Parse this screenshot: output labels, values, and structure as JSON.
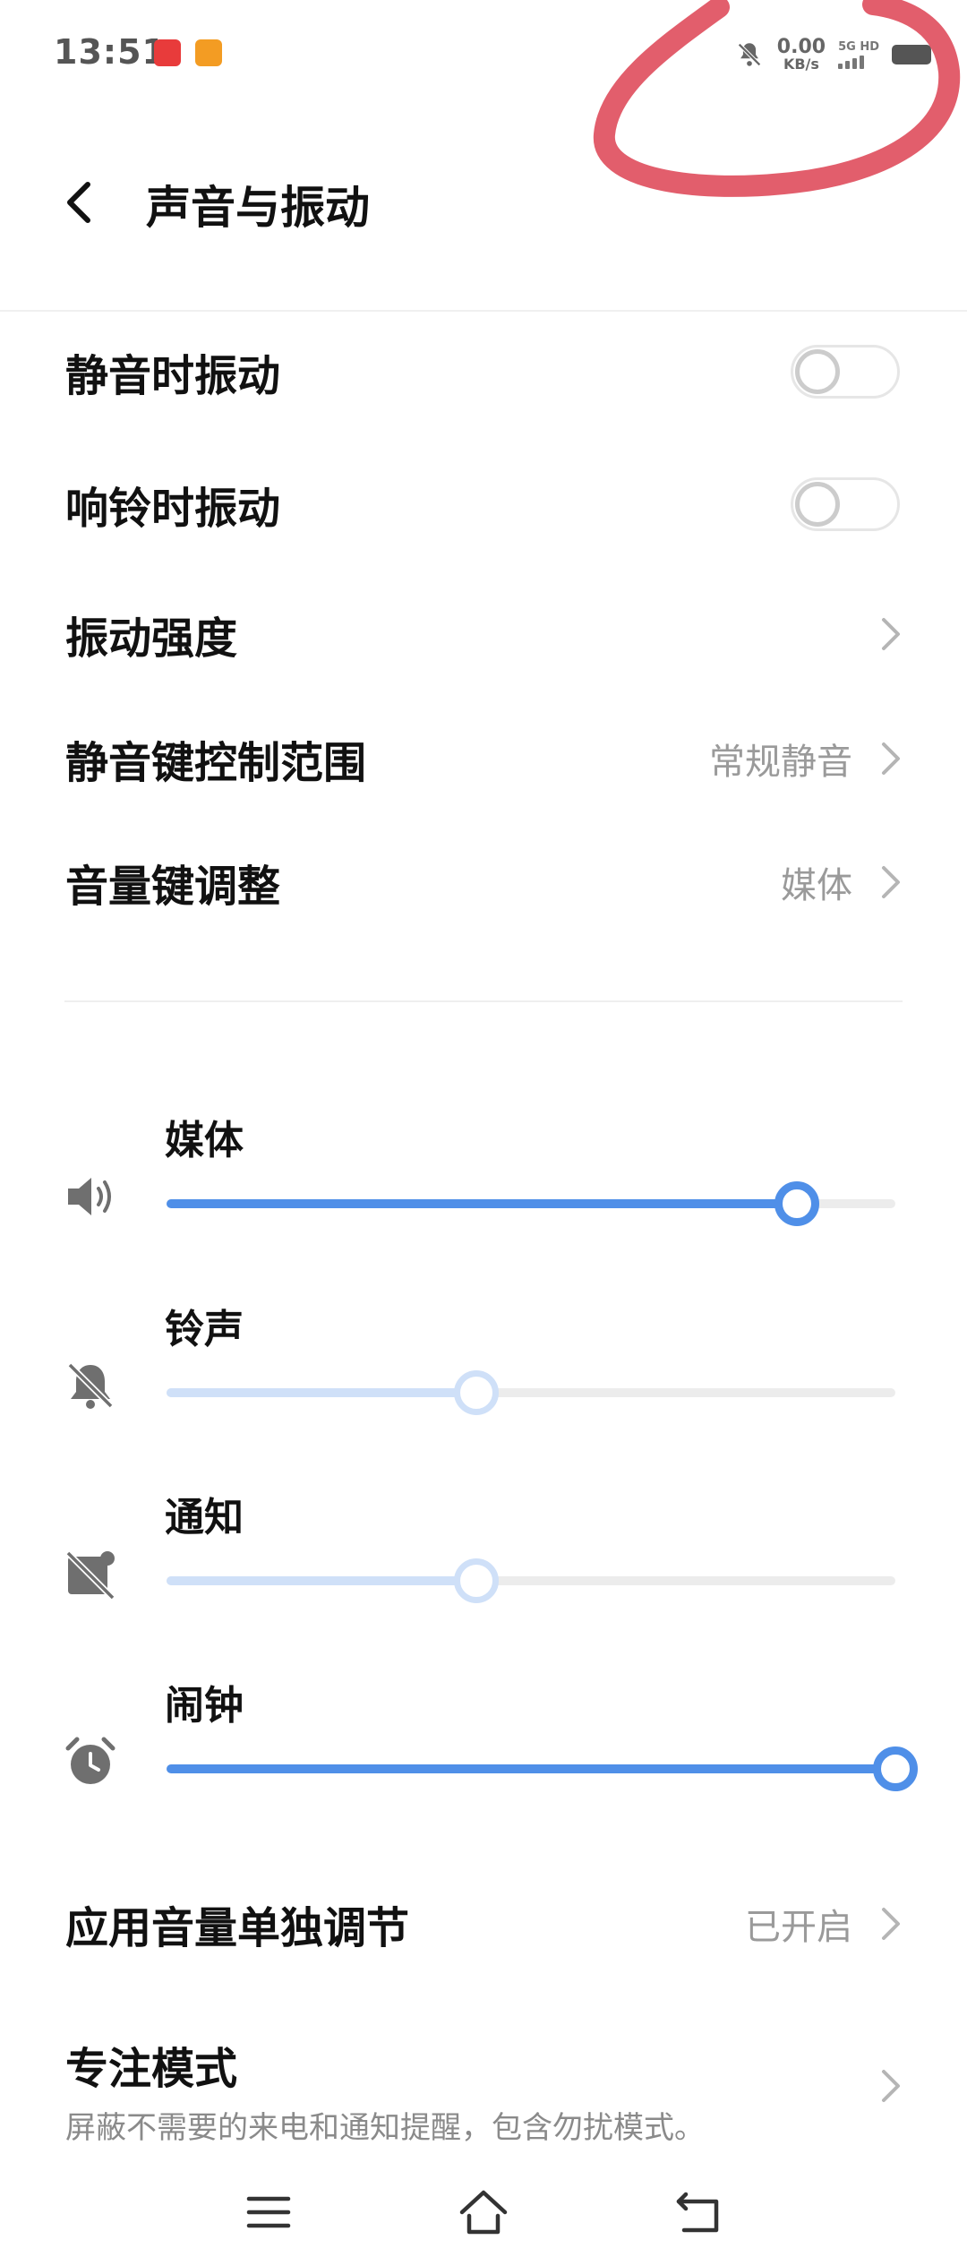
{
  "status_bar": {
    "time": "13:51",
    "net_speed_value": "0.00",
    "net_speed_unit": "KB/s",
    "network_type": "5G HD",
    "icons": [
      "app-icon-1",
      "app-icon-2",
      "bell-off-icon",
      "signal-icon",
      "battery-icon"
    ]
  },
  "header": {
    "title": "声音与振动"
  },
  "settings": {
    "vibrate_silent": {
      "label": "静音时振动",
      "enabled": false
    },
    "vibrate_ring": {
      "label": "响铃时振动",
      "enabled": false
    },
    "vibration_strength": {
      "label": "振动强度"
    },
    "mute_key_scope": {
      "label": "静音键控制范围",
      "value": "常规静音"
    },
    "volume_key_adjust": {
      "label": "音量键调整",
      "value": "媒体"
    }
  },
  "volumes": {
    "media": {
      "label": "媒体",
      "level": 0.865,
      "icon": "speaker-icon"
    },
    "ringtone": {
      "label": "铃声",
      "level": 0.425,
      "icon": "bell-off-icon"
    },
    "notification": {
      "label": "通知",
      "level": 0.425,
      "icon": "notification-off-icon"
    },
    "alarm": {
      "label": "闹钟",
      "level": 1.0,
      "icon": "alarm-clock-icon"
    }
  },
  "app_volume": {
    "label": "应用音量单独调节",
    "value": "已开启"
  },
  "focus_mode": {
    "label": "专注模式",
    "description": "屏蔽不需要的来电和通知提醒，包含勿扰模式。"
  },
  "colors": {
    "accent": "#4f8fe8",
    "accent_light": "#cfe0f8",
    "annotation": "#e05060"
  }
}
